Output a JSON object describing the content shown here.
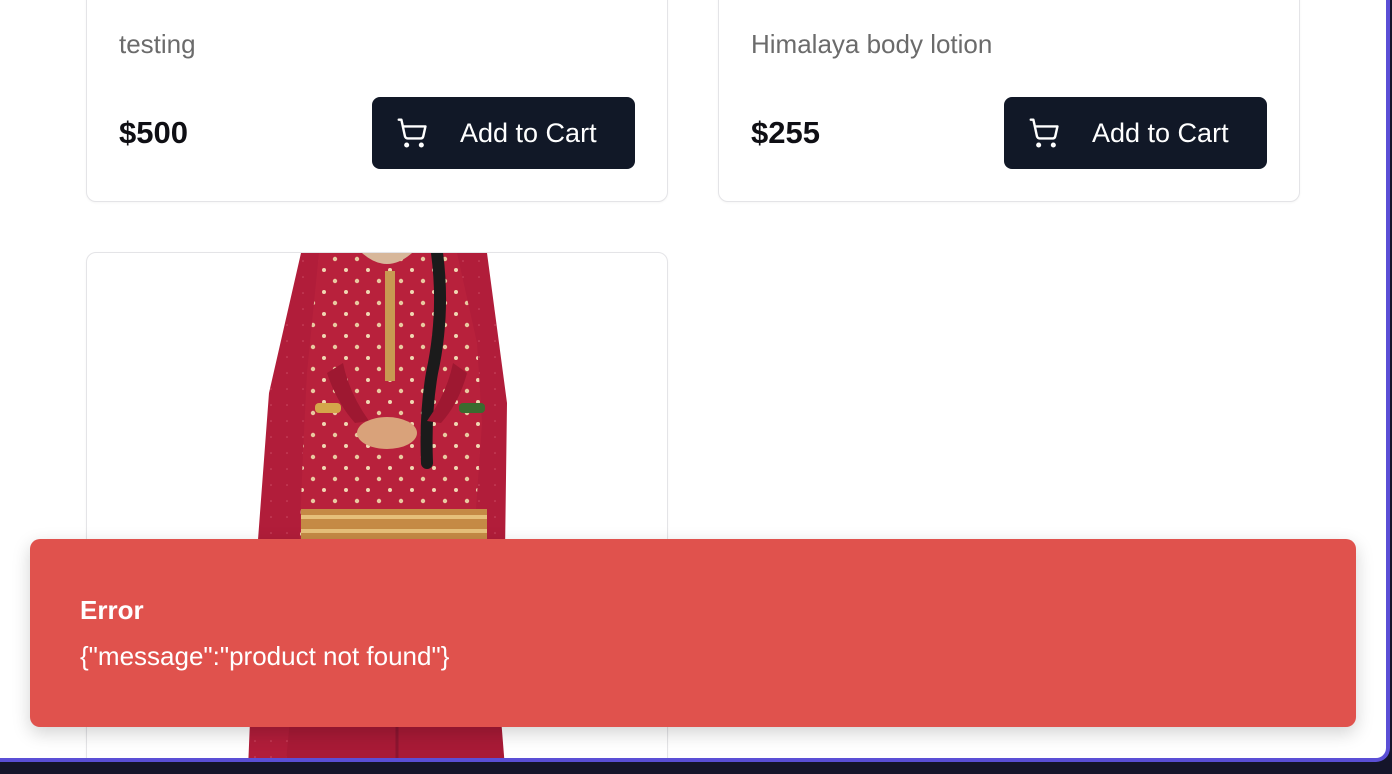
{
  "products": [
    {
      "description": "testing",
      "price": "$500",
      "button_label": "Add to Cart"
    },
    {
      "description": "Himalaya body lotion",
      "price": "$255",
      "button_label": "Add to Cart"
    }
  ],
  "toast": {
    "title": "Error",
    "message": "{\"message\":\"product not found\"}",
    "color": "#e0524d"
  },
  "colors": {
    "button_bg": "#111827",
    "accent_border": "#5b4fd6"
  },
  "icons": {
    "cart": "shopping-cart-icon"
  }
}
